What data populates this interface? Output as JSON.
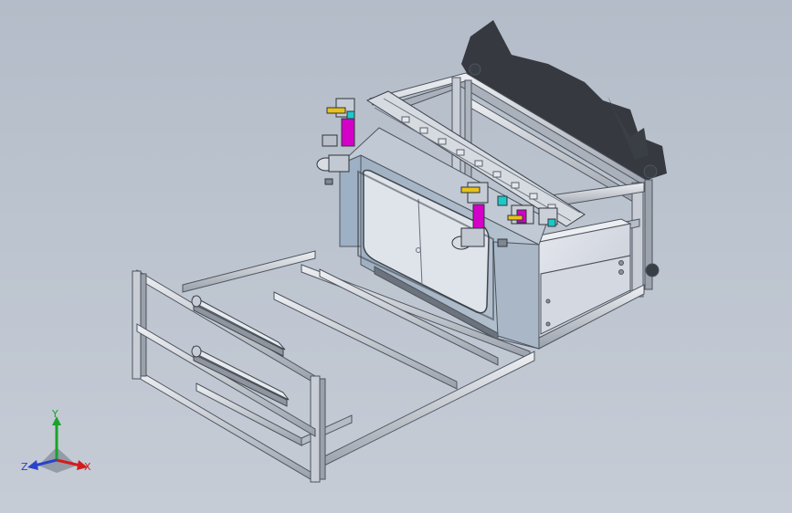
{
  "viewport": {
    "background_top": "#b3bcc8",
    "background_bottom": "#c6ccd6"
  },
  "colors": {
    "frame": "#c4cad3",
    "frame_dark": "#5f6670",
    "enclosure": "#d6dbe3",
    "panel": "#a7b5c4",
    "window": "#dbe0e8",
    "accent_magenta": "#d400c8",
    "accent_yellow": "#e8c21a",
    "accent_cyan": "#1cc9c9",
    "shadow": "#2a2d33"
  },
  "triad": {
    "y_label": "Y",
    "x_label": "X",
    "z_label": "Z",
    "y_color": "#1aa32a",
    "x_color": "#d31c1c",
    "z_color": "#2a43c9"
  }
}
